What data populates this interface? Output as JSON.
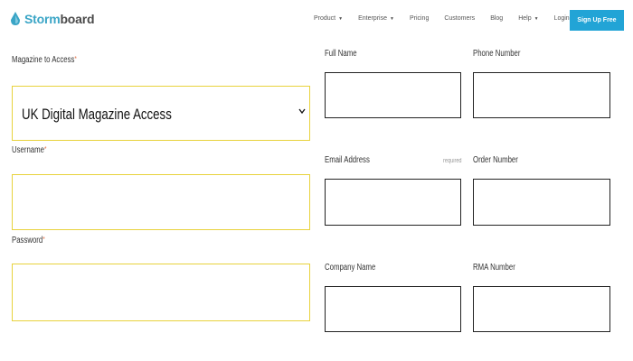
{
  "header": {
    "logo_text_a": "Storm",
    "logo_text_b": "board",
    "nav": {
      "product": "Product",
      "enterprise": "Enterprise",
      "pricing": "Pricing",
      "customers": "Customers",
      "blog": "Blog",
      "help": "Help",
      "login": "Login →"
    },
    "signup_label": "Sign Up Free"
  },
  "form": {
    "magazine_label": "Magazine to Access",
    "magazine_value": "UK Digital Magazine Access",
    "username_label": "Username",
    "password_label": "Password",
    "full_name_label": "Full Name",
    "phone_label": "Phone Number",
    "email_label": "Email Address",
    "email_hint": "required",
    "order_label": "Order Number",
    "company_label": "Company Name",
    "rma_label": "RMA Number",
    "required_star": "*"
  },
  "colors": {
    "accent": "#22a4d6",
    "field_border_highlight": "#e8d23c"
  }
}
